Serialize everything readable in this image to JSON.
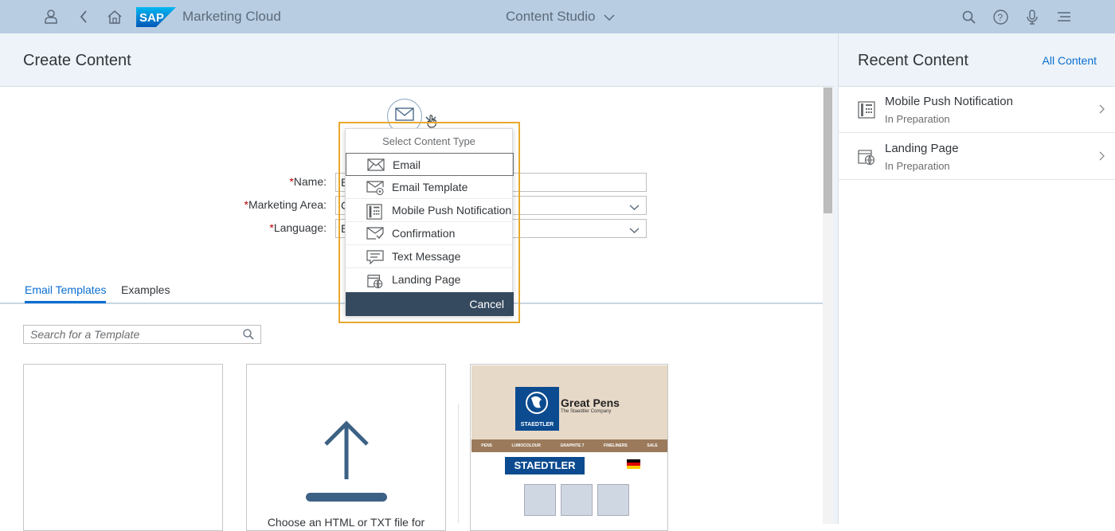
{
  "shell": {
    "app_name": "Marketing Cloud",
    "center_title": "Content Studio",
    "icons": [
      "user-icon",
      "back-icon",
      "home-icon",
      "search-icon",
      "help-icon",
      "microphone-icon",
      "notifications-icon"
    ],
    "logo_text": "SAP"
  },
  "page": {
    "title": "Create Content"
  },
  "form": {
    "required_marker": "*",
    "name_label": "Name:",
    "name_value": "E",
    "marketing_area_label": "Marketing Area:",
    "marketing_area_value": "C",
    "language_label": "Language:",
    "language_value": "E"
  },
  "tabs": [
    {
      "label": "Email Templates",
      "active": true
    },
    {
      "label": "Examples",
      "active": false
    }
  ],
  "search": {
    "placeholder": "Search for a Template"
  },
  "tiles": {
    "upload_text": "Choose an HTML or TXT file for"
  },
  "preview": {
    "logo_label": "STAEDTLER",
    "brand": "Great Pens",
    "tagline": "The Staedtler Company",
    "nav": [
      "PENS",
      "LUMOCOLOUR",
      "GRAPHITE 7",
      "FINELINERS",
      "SALE"
    ],
    "staedtler_banner": "STAEDTLER"
  },
  "popover": {
    "title": "Select Content Type",
    "items": [
      {
        "label": "Email",
        "icon": "email-icon",
        "selected": true
      },
      {
        "label": "Email Template",
        "icon": "email-template-icon",
        "selected": false
      },
      {
        "label": "Mobile Push Notification",
        "icon": "mobile-push-icon",
        "selected": false
      },
      {
        "label": "Confirmation",
        "icon": "confirmation-icon",
        "selected": false
      },
      {
        "label": "Text Message",
        "icon": "text-message-icon",
        "selected": false
      },
      {
        "label": "Landing Page",
        "icon": "landing-page-icon",
        "selected": false
      }
    ],
    "cancel_label": "Cancel"
  },
  "recent": {
    "title": "Recent Content",
    "all_link": "All Content",
    "items": [
      {
        "name": "Mobile Push Notification",
        "status": "In Preparation",
        "icon": "mobile-push-icon"
      },
      {
        "name": "Landing Page",
        "status": "In Preparation",
        "icon": "landing-page-icon"
      }
    ]
  },
  "colors": {
    "shell_bg": "#b9cde2",
    "accent": "#0a6ed1",
    "highlight_frame": "#e9a82d",
    "popover_footer": "#354a5f"
  }
}
